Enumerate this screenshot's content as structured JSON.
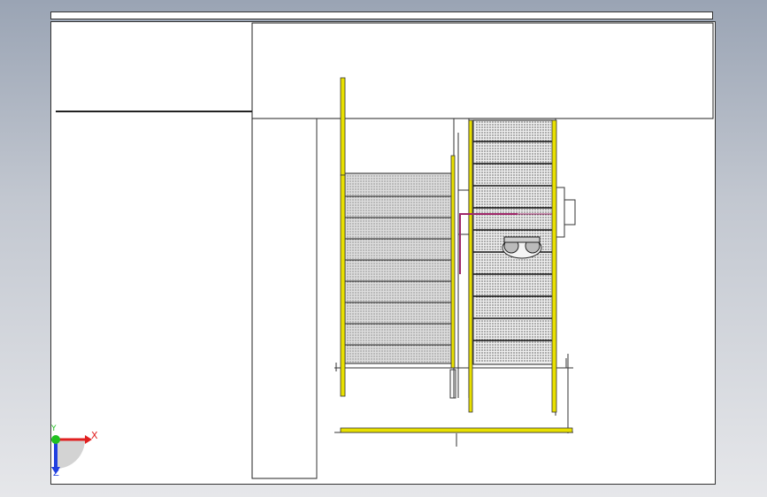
{
  "triad": {
    "x_label": "X",
    "y_label": "Y",
    "z_label": "Z",
    "x_color": "#e02020",
    "y_color": "#20c020",
    "z_color": "#2040e0"
  },
  "drawing": {
    "frame_color": "#333333",
    "rail_color": "#e8e000",
    "pipe_color": "#a0286a"
  }
}
